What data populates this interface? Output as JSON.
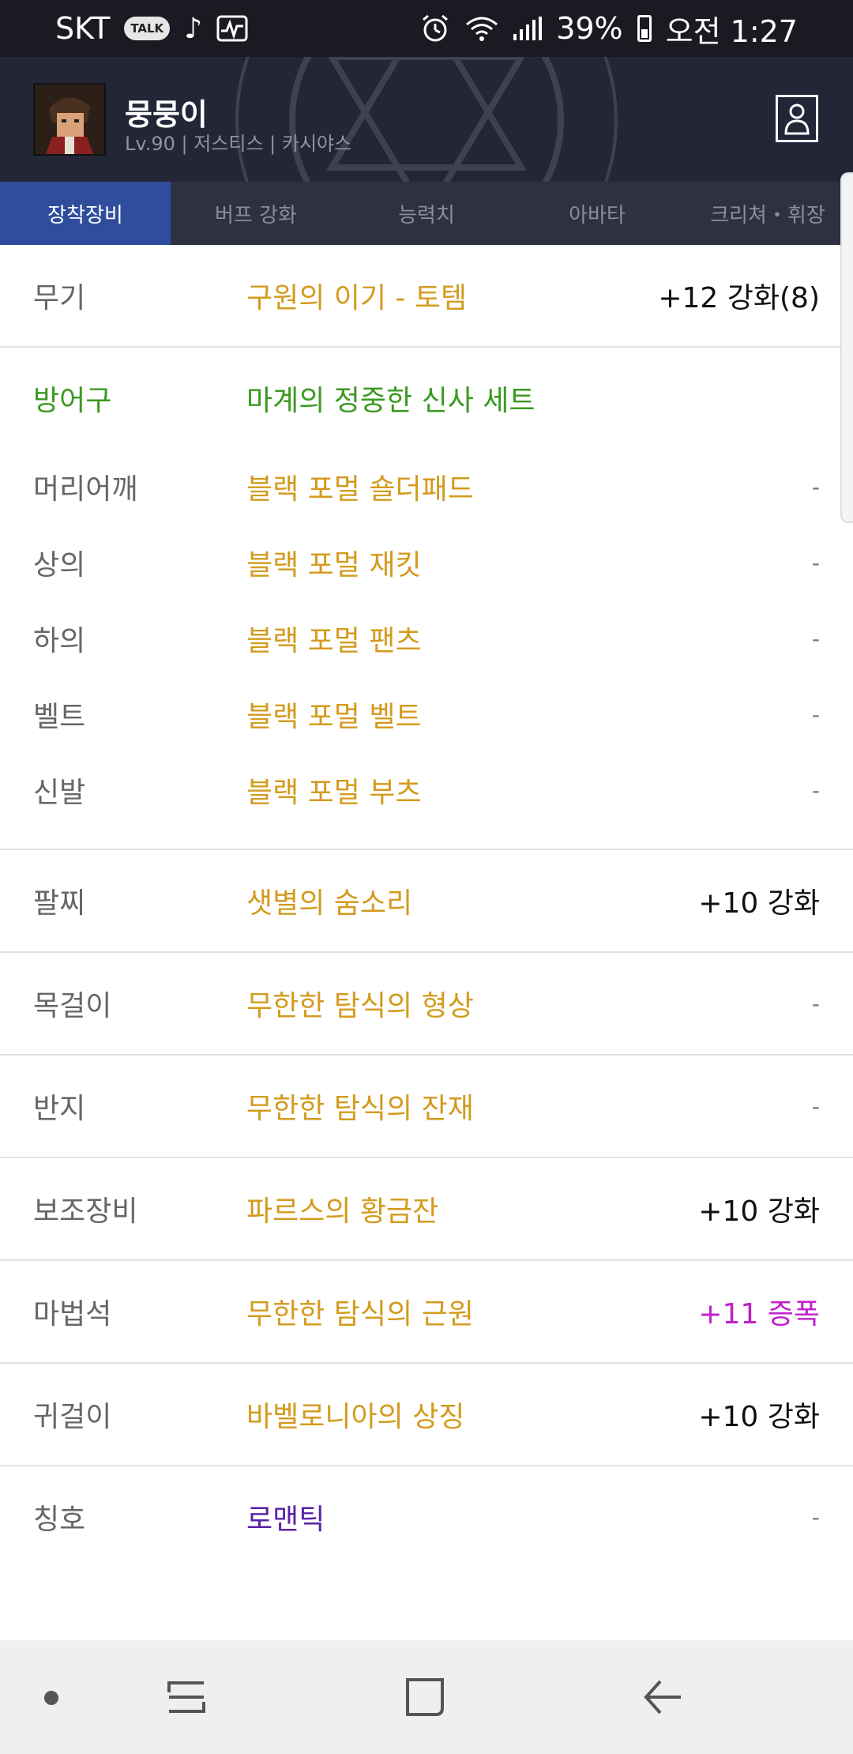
{
  "status_bar": {
    "carrier": "SKT",
    "talk_badge": "TALK",
    "battery_percent": "39%",
    "time": "오전 1:27"
  },
  "profile": {
    "name": "뭉뭉이",
    "subtitle": "Lv.90 | 저스티스 | 카시야스"
  },
  "tabs": [
    {
      "label": "장착장비",
      "active": true
    },
    {
      "label": "버프 강화"
    },
    {
      "label": "능력치"
    },
    {
      "label": "아바타"
    },
    {
      "label": "크리쳐・휘장"
    }
  ],
  "equipment": {
    "weapon": {
      "slot": "무기",
      "item": "구원의 이기 - 토템",
      "value": "+12 강화(8)"
    },
    "armor_set": {
      "slot": "방어구",
      "item": "마계의 정중한 신사 세트"
    },
    "armor": [
      {
        "slot": "머리어깨",
        "item": "블랙 포멀 숄더패드",
        "value": "-"
      },
      {
        "slot": "상의",
        "item": "블랙 포멀 재킷",
        "value": "-"
      },
      {
        "slot": "하의",
        "item": "블랙 포멀 팬츠",
        "value": "-"
      },
      {
        "slot": "벨트",
        "item": "블랙 포멀 벨트",
        "value": "-"
      },
      {
        "slot": "신발",
        "item": "블랙 포멀 부츠",
        "value": "-"
      }
    ],
    "bracelet": {
      "slot": "팔찌",
      "item": "샛별의 숨소리",
      "value": "+10 강화"
    },
    "necklace": {
      "slot": "목걸이",
      "item": "무한한 탐식의 형상",
      "value": "-"
    },
    "ring": {
      "slot": "반지",
      "item": "무한한 탐식의 잔재",
      "value": "-"
    },
    "support": {
      "slot": "보조장비",
      "item": "파르스의 황금잔",
      "value": "+10 강화"
    },
    "magic_stone": {
      "slot": "마법석",
      "item": "무한한 탐식의 근원",
      "value": "+11 증폭"
    },
    "earring": {
      "slot": "귀걸이",
      "item": "바벨로니아의 상징",
      "value": "+10 강화"
    },
    "title": {
      "slot": "칭호",
      "item": "로맨틱",
      "value": "-"
    }
  },
  "colors": {
    "item_gold": "#d39b1e",
    "set_green": "#3a9a20",
    "title_purple": "#5a22a6",
    "amplify_magenta": "#c020c8",
    "active_tab": "#2f4d9c"
  }
}
